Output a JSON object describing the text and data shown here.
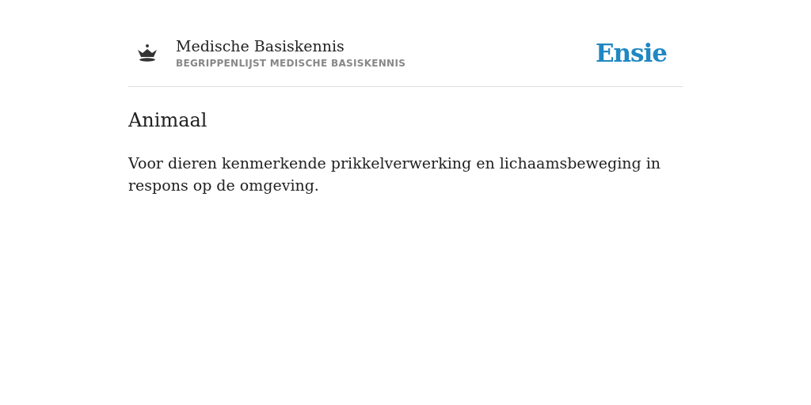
{
  "header": {
    "title": "Medische Basiskennis",
    "subtitle": "BEGRIPPENLIJST MEDISCHE BASISKENNIS",
    "brand": "Ensie"
  },
  "entry": {
    "term": "Animaal",
    "definition": "Voor dieren kenmerkende prikkelverwerking en lichaamsbeweging in respons op de omgeving."
  }
}
